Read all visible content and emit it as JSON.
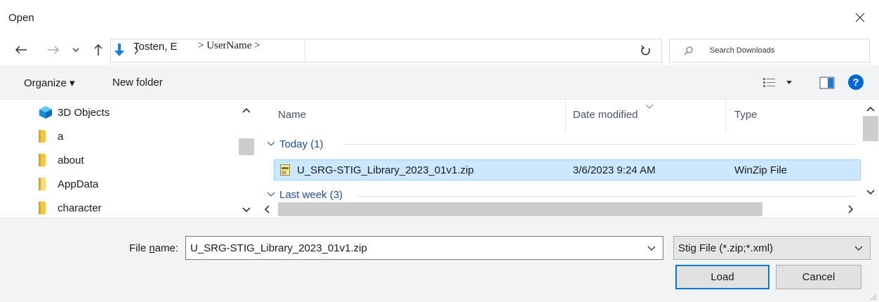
{
  "window": {
    "title": "Open",
    "close_icon": "close-icon"
  },
  "address": {
    "path_segment": "Tosten, E",
    "path_user": "> UserName >",
    "search_placeholder": "Search Downloads"
  },
  "toolbar": {
    "organize_label": "Organize ▾",
    "new_folder_label": "New folder",
    "help_label": "?"
  },
  "nav_pane": {
    "items": [
      {
        "label": "3D Objects",
        "icon": "3d-objects-icon"
      },
      {
        "label": "a",
        "icon": "folder-icon"
      },
      {
        "label": "about",
        "icon": "folder-icon"
      },
      {
        "label": "AppData",
        "icon": "folder-icon"
      },
      {
        "label": "character",
        "icon": "folder-icon"
      }
    ]
  },
  "file_list": {
    "columns": [
      "Name",
      "Date modified",
      "Type"
    ],
    "groups": [
      {
        "label": "Today (1)"
      },
      {
        "label": "Last week (3)"
      }
    ],
    "rows": [
      {
        "name": "U_SRG-STIG_Library_2023_01v1.zip",
        "date_modified": "3/6/2023 9:24 AM",
        "type": "WinZip File",
        "selected": true
      }
    ]
  },
  "bottom": {
    "file_name_label": "File name:",
    "file_name_label_mnemonic": "n",
    "file_name_value": "U_SRG-STIG_Library_2023_01v1.zip",
    "file_type_value": "Stig File (*.zip;*.xml)",
    "load_label": "Load",
    "cancel_label": "Cancel"
  },
  "colors": {
    "accent": "#0078d7",
    "selection": "#cce8ff",
    "group_text": "#1f4e9a"
  }
}
